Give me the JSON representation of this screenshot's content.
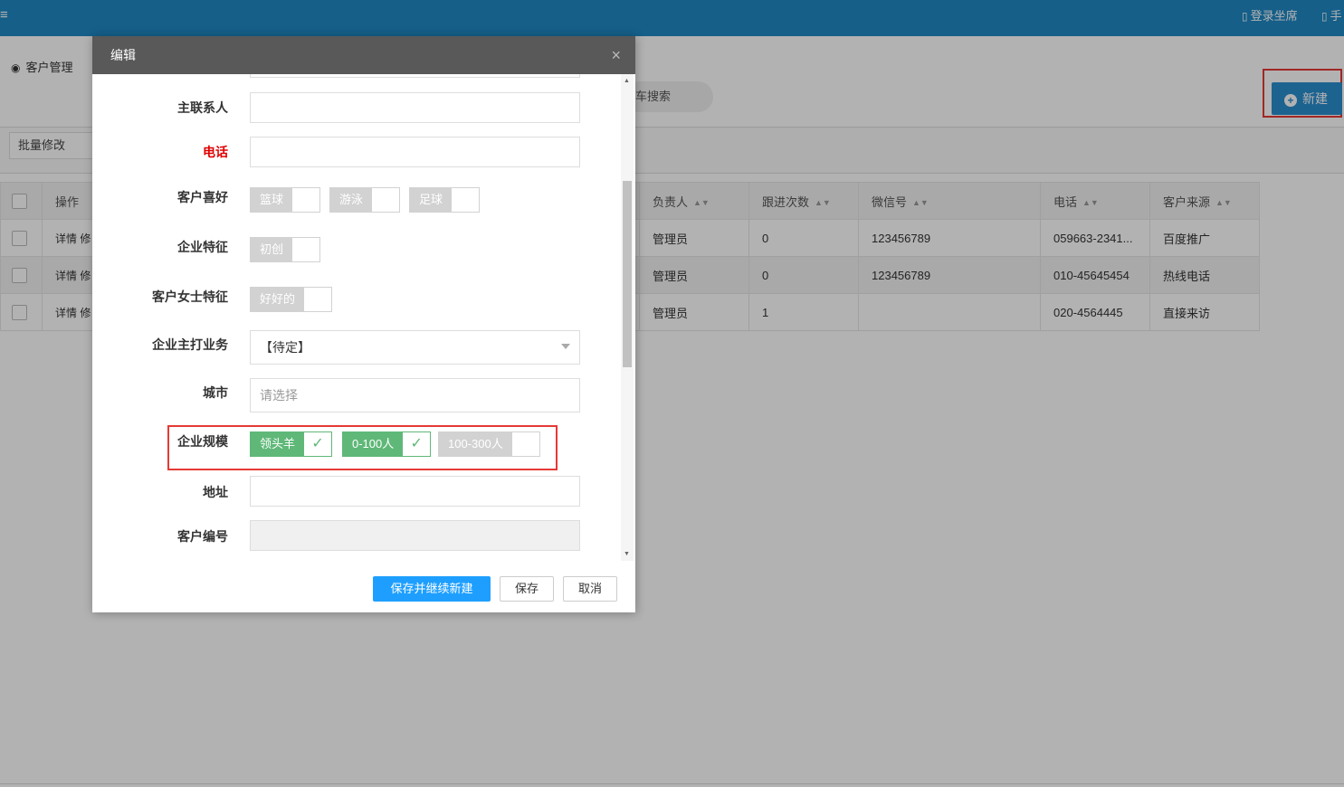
{
  "topbar": {
    "menu_icon": "menu-icon",
    "login_seat": "登录坐席",
    "mobile": "手"
  },
  "breadcrumb": {
    "icon": "dashboard-icon",
    "label": "客户管理"
  },
  "search": {
    "label": "车搜索"
  },
  "toolbar": {
    "new_label": "新建",
    "batch_edit": "批量修改"
  },
  "table": {
    "headers": {
      "ops": "操作",
      "owner": "负责人",
      "follow": "跟进次数",
      "wechat": "微信号",
      "phone": "电话",
      "source": "客户来源"
    },
    "op_detail": "详情",
    "op_more": "修",
    "rows": [
      {
        "owner": "管理员",
        "follow": "0",
        "wechat": "123456789",
        "phone": "059663-2341...",
        "source": "百度推广"
      },
      {
        "owner": "管理员",
        "follow": "0",
        "wechat": "123456789",
        "phone": "010-45645454",
        "source": "热线电话"
      },
      {
        "owner": "管理员",
        "follow": "1",
        "wechat": "",
        "phone": "020-4564445",
        "source": "直接来访"
      }
    ]
  },
  "modal": {
    "title": "编辑",
    "close": "×",
    "fields": {
      "main_contact": {
        "label": "主联系人",
        "value": ""
      },
      "phone": {
        "label": "电话",
        "value": ""
      },
      "hobby": {
        "label": "客户喜好",
        "options": [
          "篮球",
          "游泳",
          "足球"
        ]
      },
      "feature": {
        "label": "企业特征",
        "options": [
          "初创"
        ]
      },
      "lady_feature": {
        "label": "客户女士特征",
        "options": [
          "好好的"
        ]
      },
      "business": {
        "label": "企业主打业务",
        "value": "【待定】"
      },
      "city": {
        "label": "城市",
        "placeholder": "请选择"
      },
      "scale": {
        "label": "企业规模",
        "options": [
          "领头羊",
          "0-100人",
          "100-300人"
        ],
        "checked": [
          true,
          true,
          false
        ]
      },
      "address": {
        "label": "地址",
        "value": ""
      },
      "code": {
        "label": "客户编号",
        "value": ""
      }
    },
    "buttons": {
      "save_new": "保存并继续新建",
      "save": "保存",
      "cancel": "取消"
    }
  },
  "colors": {
    "topbar": "#1f88c4",
    "primary": "#1e9fff",
    "checked": "#5fb878",
    "highlight": "#e53935",
    "required": "#e00000"
  }
}
